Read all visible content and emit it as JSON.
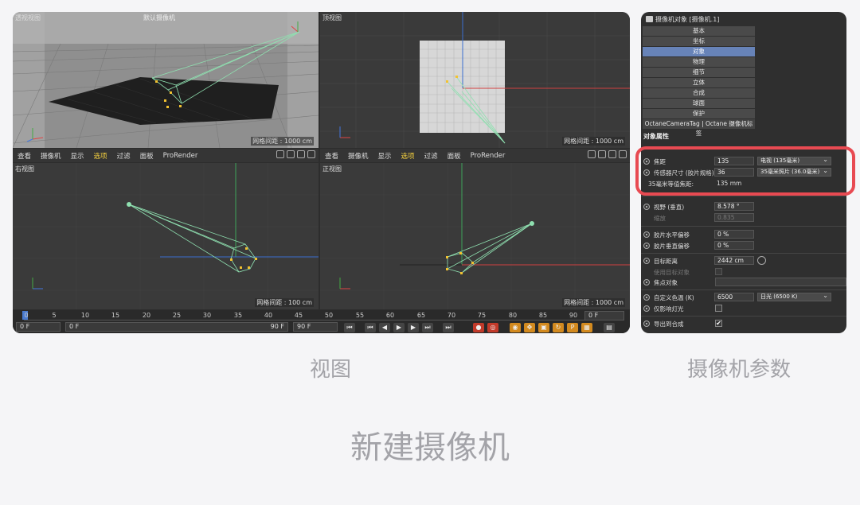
{
  "viewports": {
    "perspective": {
      "label": "透视视图",
      "camera_label": "默认摄像机",
      "grid": "网格间距 : 1000 cm"
    },
    "top": {
      "label": "顶视图",
      "grid": "网格间距 : 1000 cm"
    },
    "right": {
      "label": "右视图",
      "grid": "网格间距 : 100 cm"
    },
    "front": {
      "label": "正视图",
      "grid": "网格间距 : 1000 cm"
    },
    "menu": [
      "查看",
      "摄像机",
      "显示",
      "选项",
      "过滤",
      "面板",
      "ProRender"
    ],
    "menu_highlight": "选项"
  },
  "timeline": {
    "ticks": [
      "0",
      "5",
      "10",
      "15",
      "20",
      "25",
      "30",
      "35",
      "40",
      "45",
      "50",
      "55",
      "60",
      "65",
      "70",
      "75",
      "80",
      "85",
      "90"
    ],
    "frame_field": "0 F",
    "start_field": "0 F",
    "range_start": "0 F",
    "range_end": "90 F",
    "end_field": "90 F",
    "controls": [
      "first",
      "prev-key",
      "prev-frame",
      "play",
      "next-frame",
      "next-key",
      "last",
      "record",
      "autokey",
      "keyframe-sel",
      "move",
      "scale",
      "rotate",
      "param",
      "pla",
      "scheme"
    ]
  },
  "properties": {
    "title": "摄像机对象 [摄像机.1]",
    "tabs": [
      "基本",
      "坐标",
      "对象",
      "物理",
      "细节",
      "立体",
      "合成",
      "球面",
      "保护",
      "OctaneCameraTag | Octane 摄像机标签"
    ],
    "active_tab": "对象",
    "section": "对象属性",
    "rows": {
      "focal": {
        "label": "焦距",
        "value": "135",
        "dropdown": "电视 (135毫米)"
      },
      "sensor": {
        "label": "传感器尺寸 (胶片规格)",
        "value": "36",
        "dropdown": "35毫米照片 (36.0毫米)"
      },
      "equiv": {
        "label": "35毫米等值焦距:",
        "value": "135 mm"
      },
      "fov": {
        "label": "视野 (垂直)",
        "value": "8.578 °"
      },
      "zoom": {
        "label": "缩放",
        "value": "0.835"
      },
      "film_h": {
        "label": "胶片水平偏移",
        "value": "0 %"
      },
      "film_v": {
        "label": "胶片垂直偏移",
        "value": "0 %"
      },
      "target_dist": {
        "label": "目标距离",
        "value": "2442 cm"
      },
      "use_target": {
        "label": "使用目标对象"
      },
      "focus_obj": {
        "label": "焦点对象"
      },
      "white_bal": {
        "label": "自定义色温 (K)",
        "value": "6500",
        "dropdown": "日光 (6500 K)"
      },
      "affect_lights": {
        "label": "仅影响灯光"
      },
      "export": {
        "label": "导出到合成",
        "checked": "✔"
      }
    }
  },
  "captions": {
    "left": "视图",
    "right": "摄像机参数",
    "main": "新建摄像机"
  },
  "colors": {
    "highlight": "#e84a52",
    "active_tab": "#6783b8",
    "menu_highlight": "#f4d03f"
  }
}
